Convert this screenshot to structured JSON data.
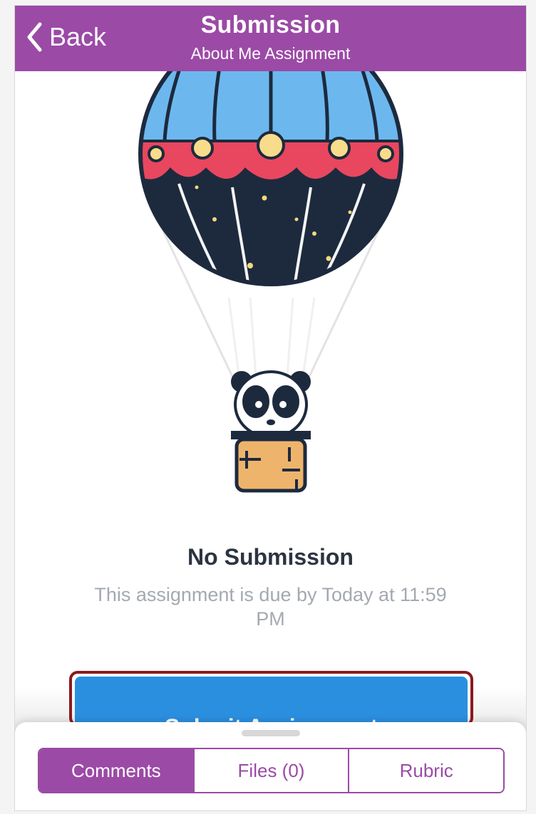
{
  "navbar": {
    "back_label": "Back",
    "title": "Submission",
    "subtitle": "About Me Assignment",
    "color": "#9b4aa6"
  },
  "illustration": {
    "icon": "hot-air-balloon-panda-icon"
  },
  "submission": {
    "status": "No Submission",
    "due_text": "This assignment is due by Today at 11:59 PM"
  },
  "submit_button": {
    "label": "Submit Assignment",
    "color": "#2b8fe0",
    "highlight_color": "#8b1a1f"
  },
  "tabs": [
    {
      "label": "Comments",
      "active": true
    },
    {
      "label": "Files (0)",
      "active": false
    },
    {
      "label": "Rubric",
      "active": false
    }
  ]
}
